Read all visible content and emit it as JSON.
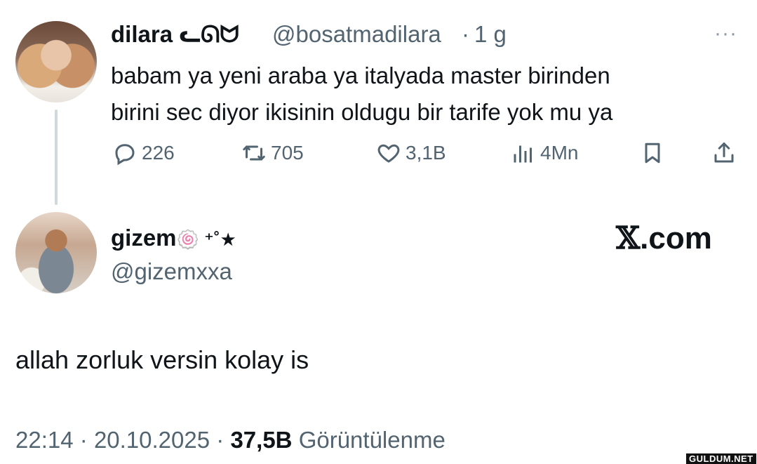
{
  "tweet": {
    "author_name": "dilara ᓚᘏᗢ",
    "author_handle": "@bosatmadilara",
    "separator": "·",
    "time_ago": "1 g",
    "more_icon": "more-icon",
    "text": "babam ya yeni araba ya italyada master birinden\nbirini sec diyor ikisinin oldugu bir tarife yok mu ya",
    "actions": {
      "replies": "226",
      "retweets": "705",
      "likes": "3,1B",
      "views": "4Mn"
    }
  },
  "reply": {
    "author_name": "gizem",
    "name_decoration": "🍥 ⁺˚★",
    "author_handle": "@gizemxxa",
    "brand": "𝕏",
    "brand_suffix": ".com",
    "text": "allah zorluk versin kolay is",
    "time": "22:14",
    "date": "20.10.2025",
    "views_count": "37,5B",
    "views_label": "Görüntülenme",
    "sep": "·"
  },
  "watermark": "GULDUM.NET",
  "colors": {
    "text": "#0f1419",
    "secondary": "#536471",
    "thread_line": "#cfd9de"
  }
}
